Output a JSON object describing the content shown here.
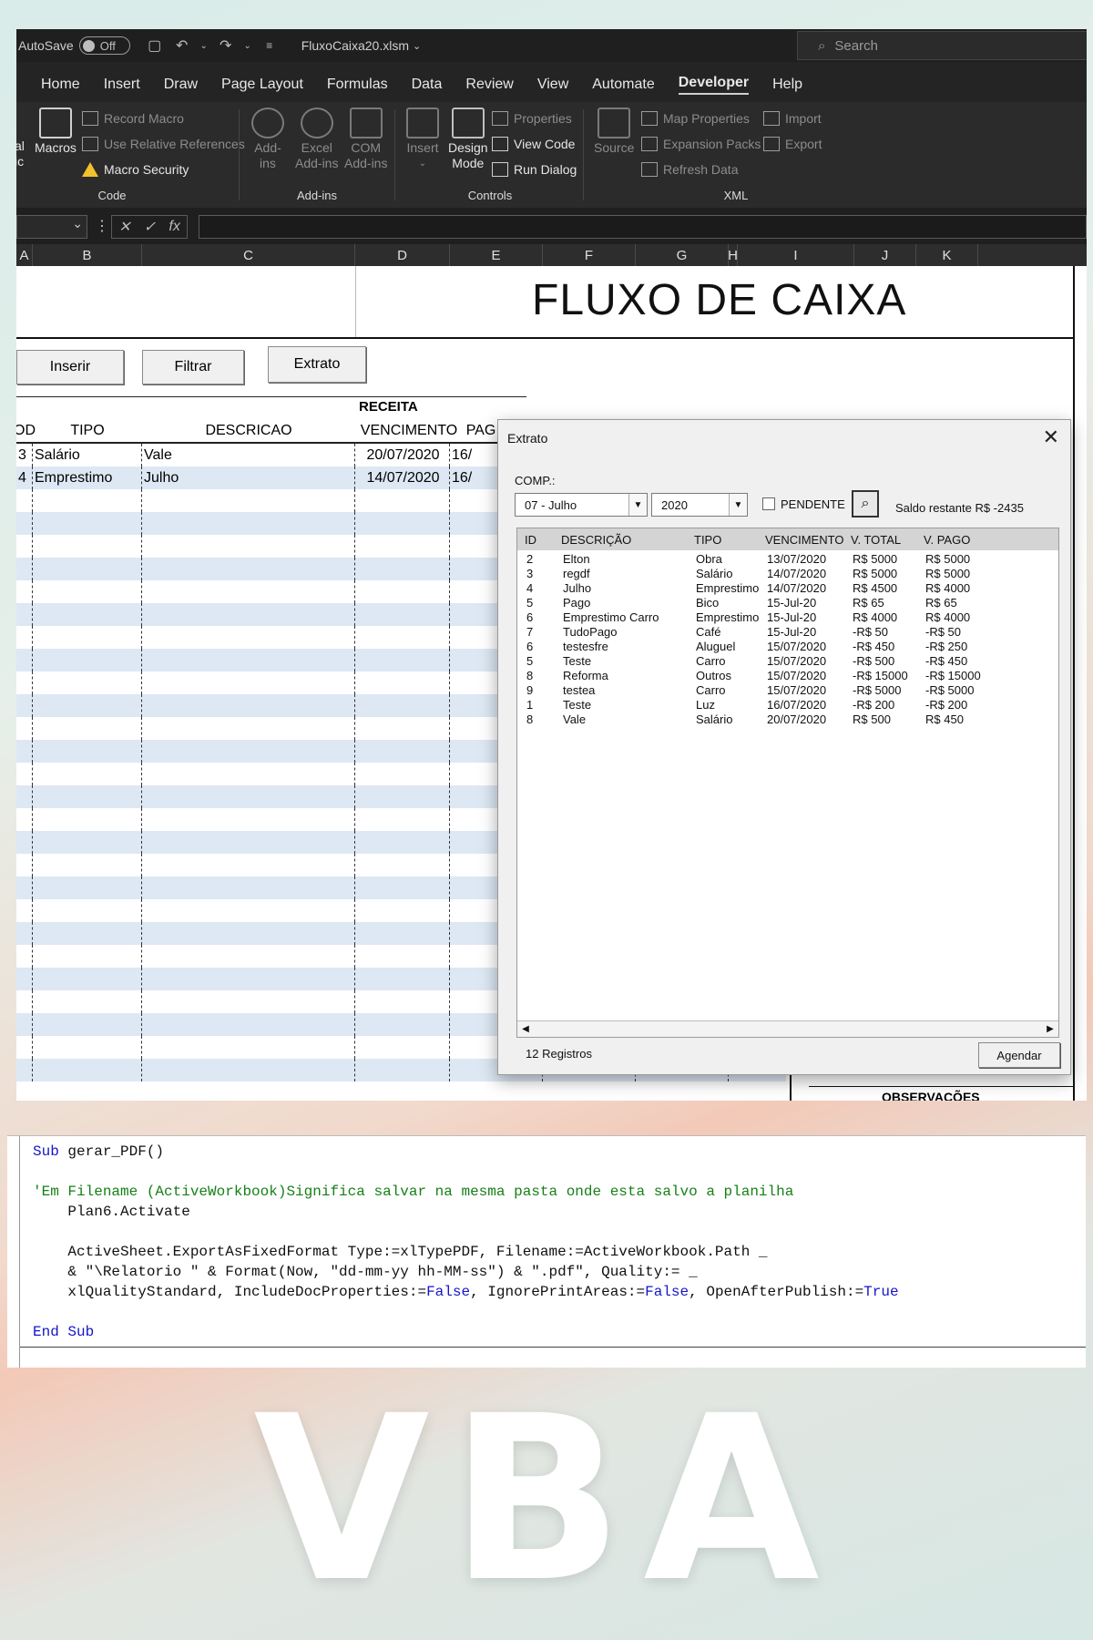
{
  "titlebar": {
    "autosave_label": "AutoSave",
    "autosave_state": "Off",
    "filename": "FluxoCaixa20.xlsm",
    "search_placeholder": "Search"
  },
  "menu": [
    "Home",
    "Insert",
    "Draw",
    "Page Layout",
    "Formulas",
    "Data",
    "Review",
    "View",
    "Automate",
    "Developer",
    "Help"
  ],
  "menu_active": "Developer",
  "ribbon": {
    "code": {
      "partial_label_1": "al",
      "partial_label_2": "ic",
      "macros": "Macros",
      "record_macro": "Record Macro",
      "relative_refs": "Use Relative References",
      "macro_security": "Macro Security",
      "group": "Code"
    },
    "addins": {
      "addins": "Add-\nins",
      "excel_addins": "Excel\nAdd-ins",
      "com_addins": "COM\nAdd-ins",
      "group": "Add-ins"
    },
    "controls": {
      "insert": "Insert",
      "design_mode": "Design\nMode",
      "properties": "Properties",
      "view_code": "View Code",
      "run_dialog": "Run Dialog",
      "group": "Controls"
    },
    "xml": {
      "source": "Source",
      "map_properties": "Map Properties",
      "expansion_packs": "Expansion Packs",
      "refresh_data": "Refresh Data",
      "import": "Import",
      "export": "Export",
      "group": "XML"
    }
  },
  "columns": [
    "A",
    "B",
    "C",
    "D",
    "E",
    "F",
    "G",
    "H",
    "I",
    "J",
    "K"
  ],
  "sheet": {
    "title": "FLUXO DE CAIXA",
    "buttons": {
      "inserir": "Inserir",
      "filtrar": "Filtrar",
      "extrato": "Extrato"
    },
    "section": "RECEITA",
    "headers": {
      "cod": "OD",
      "tipo": "TIPO",
      "descricao": "DESCRICAO",
      "vencimento": "VENCIMENTO",
      "pag": "PAG"
    },
    "rows": [
      {
        "cod": "3",
        "tipo": "Salário",
        "descricao": "Vale",
        "vencimento": "20/07/2020",
        "pag": "16/"
      },
      {
        "cod": "4",
        "tipo": "Emprestimo",
        "descricao": "Julho",
        "vencimento": "14/07/2020",
        "pag": "16/"
      }
    ],
    "observacoes": "OBSERVAÇÕES"
  },
  "dialog": {
    "title": "Extrato",
    "comp_label": "COMP.:",
    "month": "07 - Julho",
    "year": "2020",
    "pendente": "PENDENTE",
    "saldo": "Saldo restante R$ -2435",
    "headers": [
      "ID",
      "DESCRIÇÃO",
      "TIPO",
      "VENCIMENTO",
      "V. TOTAL",
      "V. PAGO"
    ],
    "rows": [
      [
        "2",
        "Elton",
        "Obra",
        "13/07/2020",
        "R$ 5000",
        "R$ 5000"
      ],
      [
        "3",
        "regdf",
        "Salário",
        "14/07/2020",
        "R$ 5000",
        "R$ 5000"
      ],
      [
        "4",
        "Julho",
        "Emprestimo",
        "14/07/2020",
        "R$ 4500",
        "R$ 4000"
      ],
      [
        "5",
        "Pago",
        "Bico",
        "15-Jul-20",
        "R$ 65",
        "R$ 65"
      ],
      [
        "6",
        "Emprestimo Carro",
        "Emprestimo",
        "15-Jul-20",
        "R$ 4000",
        "R$ 4000"
      ],
      [
        "7",
        "TudoPago",
        "Café",
        "15-Jul-20",
        "-R$ 50",
        "-R$ 50"
      ],
      [
        "6",
        "testesfre",
        "Aluguel",
        "15/07/2020",
        "-R$ 450",
        "-R$ 250"
      ],
      [
        "5",
        "Teste",
        "Carro",
        "15/07/2020",
        "-R$ 500",
        "-R$ 450"
      ],
      [
        "8",
        "Reforma",
        "Outros",
        "15/07/2020",
        "-R$ 15000",
        "-R$ 15000"
      ],
      [
        "9",
        "testea",
        "Carro",
        "15/07/2020",
        "-R$ 5000",
        "-R$ 5000"
      ],
      [
        "1",
        "Teste",
        "Luz",
        "16/07/2020",
        "-R$ 200",
        "-R$ 200"
      ],
      [
        "8",
        "Vale",
        "Salário",
        "20/07/2020",
        "R$ 500",
        "R$ 450"
      ]
    ],
    "count": "12 Registros",
    "agendar": "Agendar"
  },
  "code_lines": [
    [
      [
        "kw",
        "Sub"
      ],
      [
        "t",
        " gerar_PDF()"
      ]
    ],
    [],
    [
      [
        "cm",
        "'Em Filename (ActiveWorkbook)Significa salvar na mesma pasta onde esta salvo a planilha"
      ]
    ],
    [
      [
        "t",
        "    Plan6.Activate"
      ]
    ],
    [],
    [
      [
        "t",
        "    ActiveSheet.ExportAsFixedFormat Type:=xlTypePDF, Filename:=ActiveWorkbook.Path _"
      ]
    ],
    [
      [
        "t",
        "    & \"\\Relatorio \" & Format(Now, \"dd-mm-yy hh-MM-ss\") & \".pdf\", Quality:= _"
      ]
    ],
    [
      [
        "t",
        "    xlQualityStandard, IncludeDocProperties:="
      ],
      [
        "kw",
        "False"
      ],
      [
        "t",
        ", IgnorePrintAreas:="
      ],
      [
        "kw",
        "False"
      ],
      [
        "t",
        ", OpenAfterPublish:="
      ],
      [
        "kw",
        "True"
      ]
    ],
    [],
    [
      [
        "kw",
        "End Sub"
      ]
    ]
  ],
  "banner": "VBA"
}
